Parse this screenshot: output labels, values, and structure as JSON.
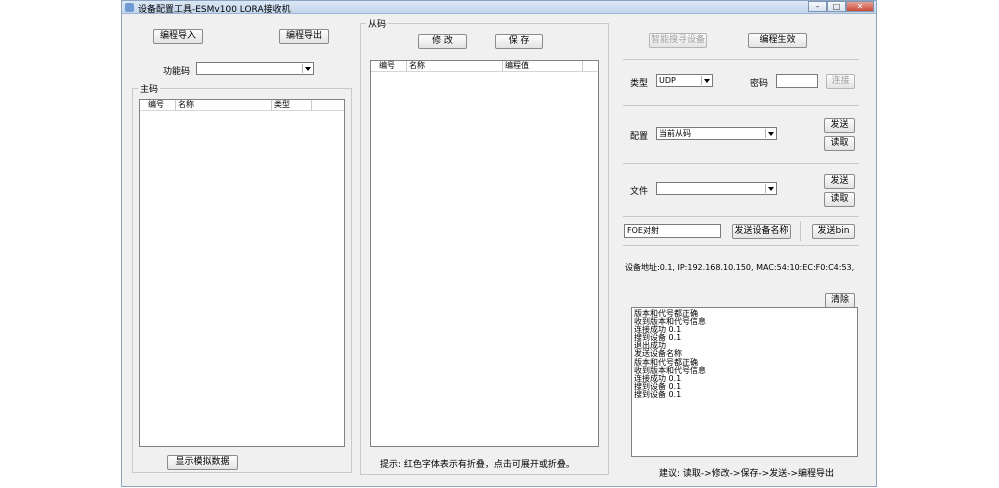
{
  "window": {
    "title": "设备配置工具-ESMv100 LORA接收机",
    "controls": [
      "–",
      "□",
      "✕"
    ]
  },
  "left": {
    "import_button": "编程导入",
    "export_button": "编程导出",
    "func_code_label": "功能码",
    "func_code_value": "",
    "group_title": "主码",
    "columns": [
      "编号",
      "名称",
      "类型"
    ],
    "show_sim_button": "显示模拟数据"
  },
  "middle": {
    "group_title": "从码",
    "modify_button": "修 改",
    "save_button": "保 存",
    "columns": [
      "编号",
      "名称",
      "编程值"
    ],
    "tip": "提示: 红色字体表示有折叠，点击可展开或折叠。"
  },
  "right": {
    "smart_search_button": "智能搜寻设备",
    "program_apply_button": "编程生效",
    "type_label": "类型",
    "type_value": "UDP",
    "password_label": "密码",
    "password_value": "",
    "connect_button": "连接",
    "config_label": "配置",
    "config_value": "当前从码",
    "send_button_1": "发送",
    "read_button_1": "读取",
    "file_label": "文件",
    "file_value": "",
    "send_button_2": "发送",
    "read_button_2": "读取",
    "device_name_value": "FOE对射",
    "send_device_name_button": "发送设备名称",
    "send_bin_button": "发送bin",
    "device_address": "设备地址:0.1, IP:192.168.10.150, MAC:54:10:EC:F0:C4:53,",
    "clear_button": "清除",
    "log_lines": [
      "版本和代号都正确",
      "收到版本和代号信息",
      "连接成功 0.1",
      "搜到设备 0.1",
      "退出成功",
      "发送设备名称",
      "版本和代号都正确",
      "收到版本和代号信息",
      "连接成功 0.1",
      "搜到设备 0.1",
      "搜到设备 0.1"
    ],
    "suggestion": "建议: 读取->修改->保存->发送->编程导出"
  }
}
